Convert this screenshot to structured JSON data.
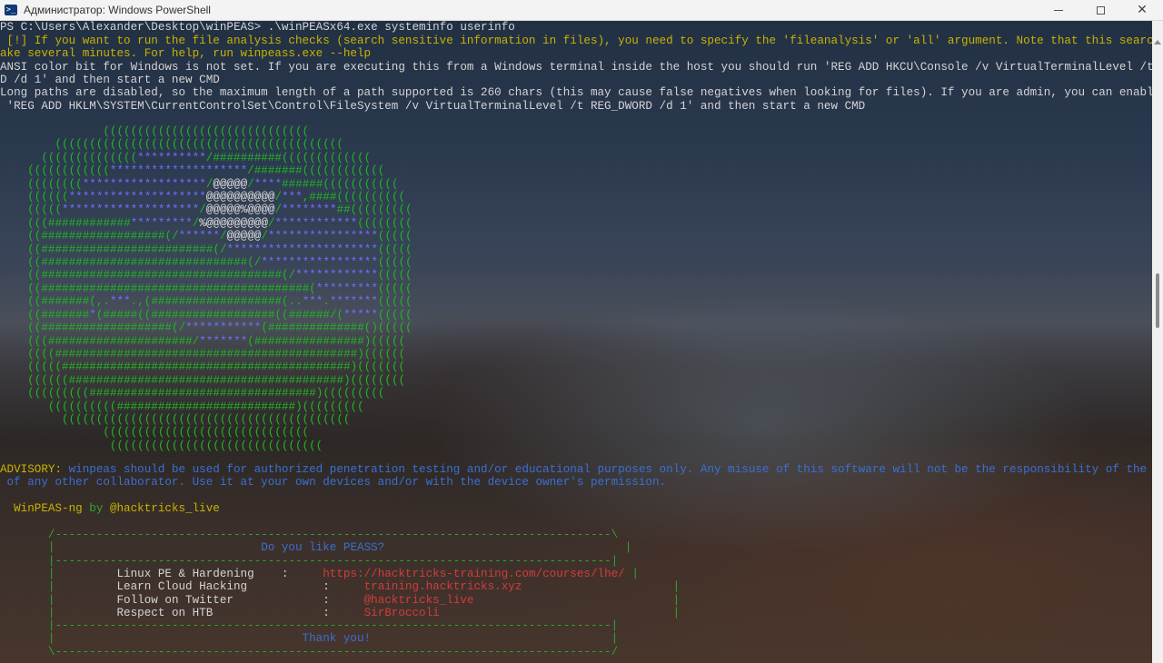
{
  "window": {
    "title": "Администратор: Windows PowerShell",
    "icon": "powershell-icon",
    "icon_glyph": ">_"
  },
  "terminal": {
    "prompt": "PS C:\\Users\\Alexander\\Desktop\\winPEAS>",
    "command": " .\\winPEASx64.exe systeminfo userinfo",
    "warning_1": " [!] If you want to run the file analysis checks (search sensitive information in files), you need to specify the 'fileanalysis' or 'all' argument. Note that this search might t",
    "warning_2": "ake several minutes. For help, run winpeass.exe --help",
    "ansi_1": "ANSI color bit for Windows is not set. If you are executing this from a Windows terminal inside the host you should run 'REG ADD HKCU\\Console /v VirtualTerminalLevel /t REG_DWOR",
    "ansi_2": "D /d 1' and then start a new CMD",
    "longpaths_1": "Long paths are disabled, so the maximum length of a path supported is 260 chars (this may cause false negatives when looking for files). If you are admin, you can enable it with",
    "longpaths_2": " 'REG ADD HKLM\\SYSTEM\\CurrentControlSet\\Control\\FileSystem /v VirtualTerminalLevel /t REG_DWORD /d 1' and then start a new CMD",
    "advisory_label": "ADVISORY:",
    "advisory_1": " winpeas should be used for authorized penetration testing and/or educational purposes only. Any misuse of this software will not be the responsibility of the author or",
    "advisory_2": " of any other collaborator. Use it at your own devices and/or with the device owner's permission.",
    "brand_name": "  WinPEAS-ng",
    "brand_by": " by ",
    "brand_handle": "@hacktricks_live"
  },
  "banner": {
    "border_top": "       /---------------------------------------------------------------------------------\\",
    "border_side_pre": "       |",
    "border_side_post": "|",
    "border_sep": "       |---------------------------------------------------------------------------------|",
    "border_bottom": "       \\---------------------------------------------------------------------------------/",
    "question": "Do you like PEASS?",
    "rows": [
      {
        "label": "Linux PE & Hardening",
        "sep": ":",
        "value": "https://hacktricks-training.com/courses/lhe/"
      },
      {
        "label": "Learn Cloud Hacking",
        "sep": ":",
        "value": "training.hacktricks.xyz"
      },
      {
        "label": "Follow on Twitter",
        "sep": ":",
        "value": "@hacktricks_live"
      },
      {
        "label": "Respect on HTB",
        "sep": ":",
        "value": "SirBroccoli"
      }
    ],
    "thanks": "Thank you!"
  },
  "ascii_art": [
    "               ((((((((((((((((((((((((((((((",
    "        ((((((((((((((((((((((((((((((((((((((((((",
    "      ((((((((((((((**********/##########(((((((((((((",
    "    ((((((((((((********************/#######((((((((((((",
    "    ((((((((******************/@@@@@/****######(((((((((((",
    "    ((((((********************@@@@@@@@@@/***,####((((((((((",
    "    (((((********************/@@@@@%@@@@/********##(((((((((",
    "    (((############*********/%@@@@@@@@@/************((((((((",
    "    ((##################(/******/@@@@@/****************(((((",
    "    ((#########################(/**********************(((((",
    "    ((##############################(/*****************(((((",
    "    ((###################################(/************(((((",
    "    ((#######################################(*********(((((",
    "    ((#######(,.***.,(###################(..***.*******(((((",
    "    ((#######*(#####((##################((######/(*****(((((",
    "    ((###################(/***********(##############()(((((",
    "    (((#####################/*******(################)(((((",
    "    ((((############################################)((((((",
    "    (((((##########################################)(((((((",
    "    ((((((########################################)((((((((",
    "    (((((((((#################################)(((((((((",
    "       ((((((((((##########################)(((((((((",
    "         ((((((((((((((((((((((((((((((((((((((((((",
    "               ((((((((((((((((((((((((((((((",
    "                ((((((((((((((((((((((((((((((("
  ]
}
